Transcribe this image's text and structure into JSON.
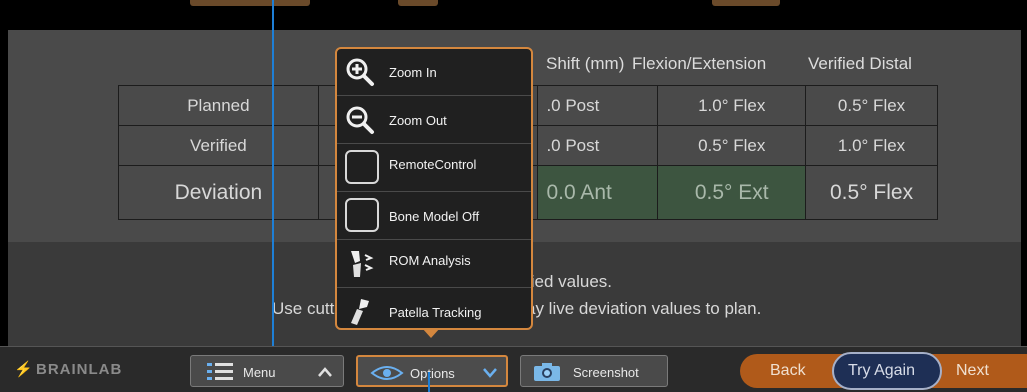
{
  "table": {
    "headers": [
      "Shift (mm)",
      "Flexion/Extension",
      "Verified Distal"
    ],
    "rows": [
      {
        "label": "Planned",
        "shift": ".0 Post",
        "flexext": "1.0° Flex",
        "distal": "0.5° Flex"
      },
      {
        "label": "Verified",
        "shift": ".0 Post",
        "flexext": "0.5° Flex",
        "distal": "1.0° Flex"
      },
      {
        "label": "Deviation",
        "shift": "0.0 Ant",
        "flexext": "0.5° Ext",
        "distal": "0.5° Flex"
      }
    ]
  },
  "message": {
    "line1_fragment": "fied values.",
    "line2_left": "Use cutti",
    "line2_right": "ay live deviation values to plan."
  },
  "popup": {
    "items": [
      {
        "label": "Zoom In",
        "icon": "zoom-in-icon"
      },
      {
        "label": "Zoom Out",
        "icon": "zoom-out-icon"
      },
      {
        "label": "RemoteControl",
        "icon": "checkbox-icon"
      },
      {
        "label": "Bone Model Off",
        "icon": "checkbox-icon"
      },
      {
        "label": "ROM Analysis",
        "icon": "knee-joint-icon"
      },
      {
        "label": "Patella Tracking",
        "icon": "patella-icon"
      }
    ]
  },
  "toolbar": {
    "logo": "BRAINLAB",
    "menu_label": "Menu",
    "options_label": "Options",
    "screenshot_label": "Screenshot",
    "back_label": "Back",
    "tryagain_label": "Try Again",
    "next_label": "Next"
  },
  "colors": {
    "accent_orange": "#d4873e",
    "highlight_blue": "#1e7fd6",
    "deviation_green": "#3d5540"
  }
}
